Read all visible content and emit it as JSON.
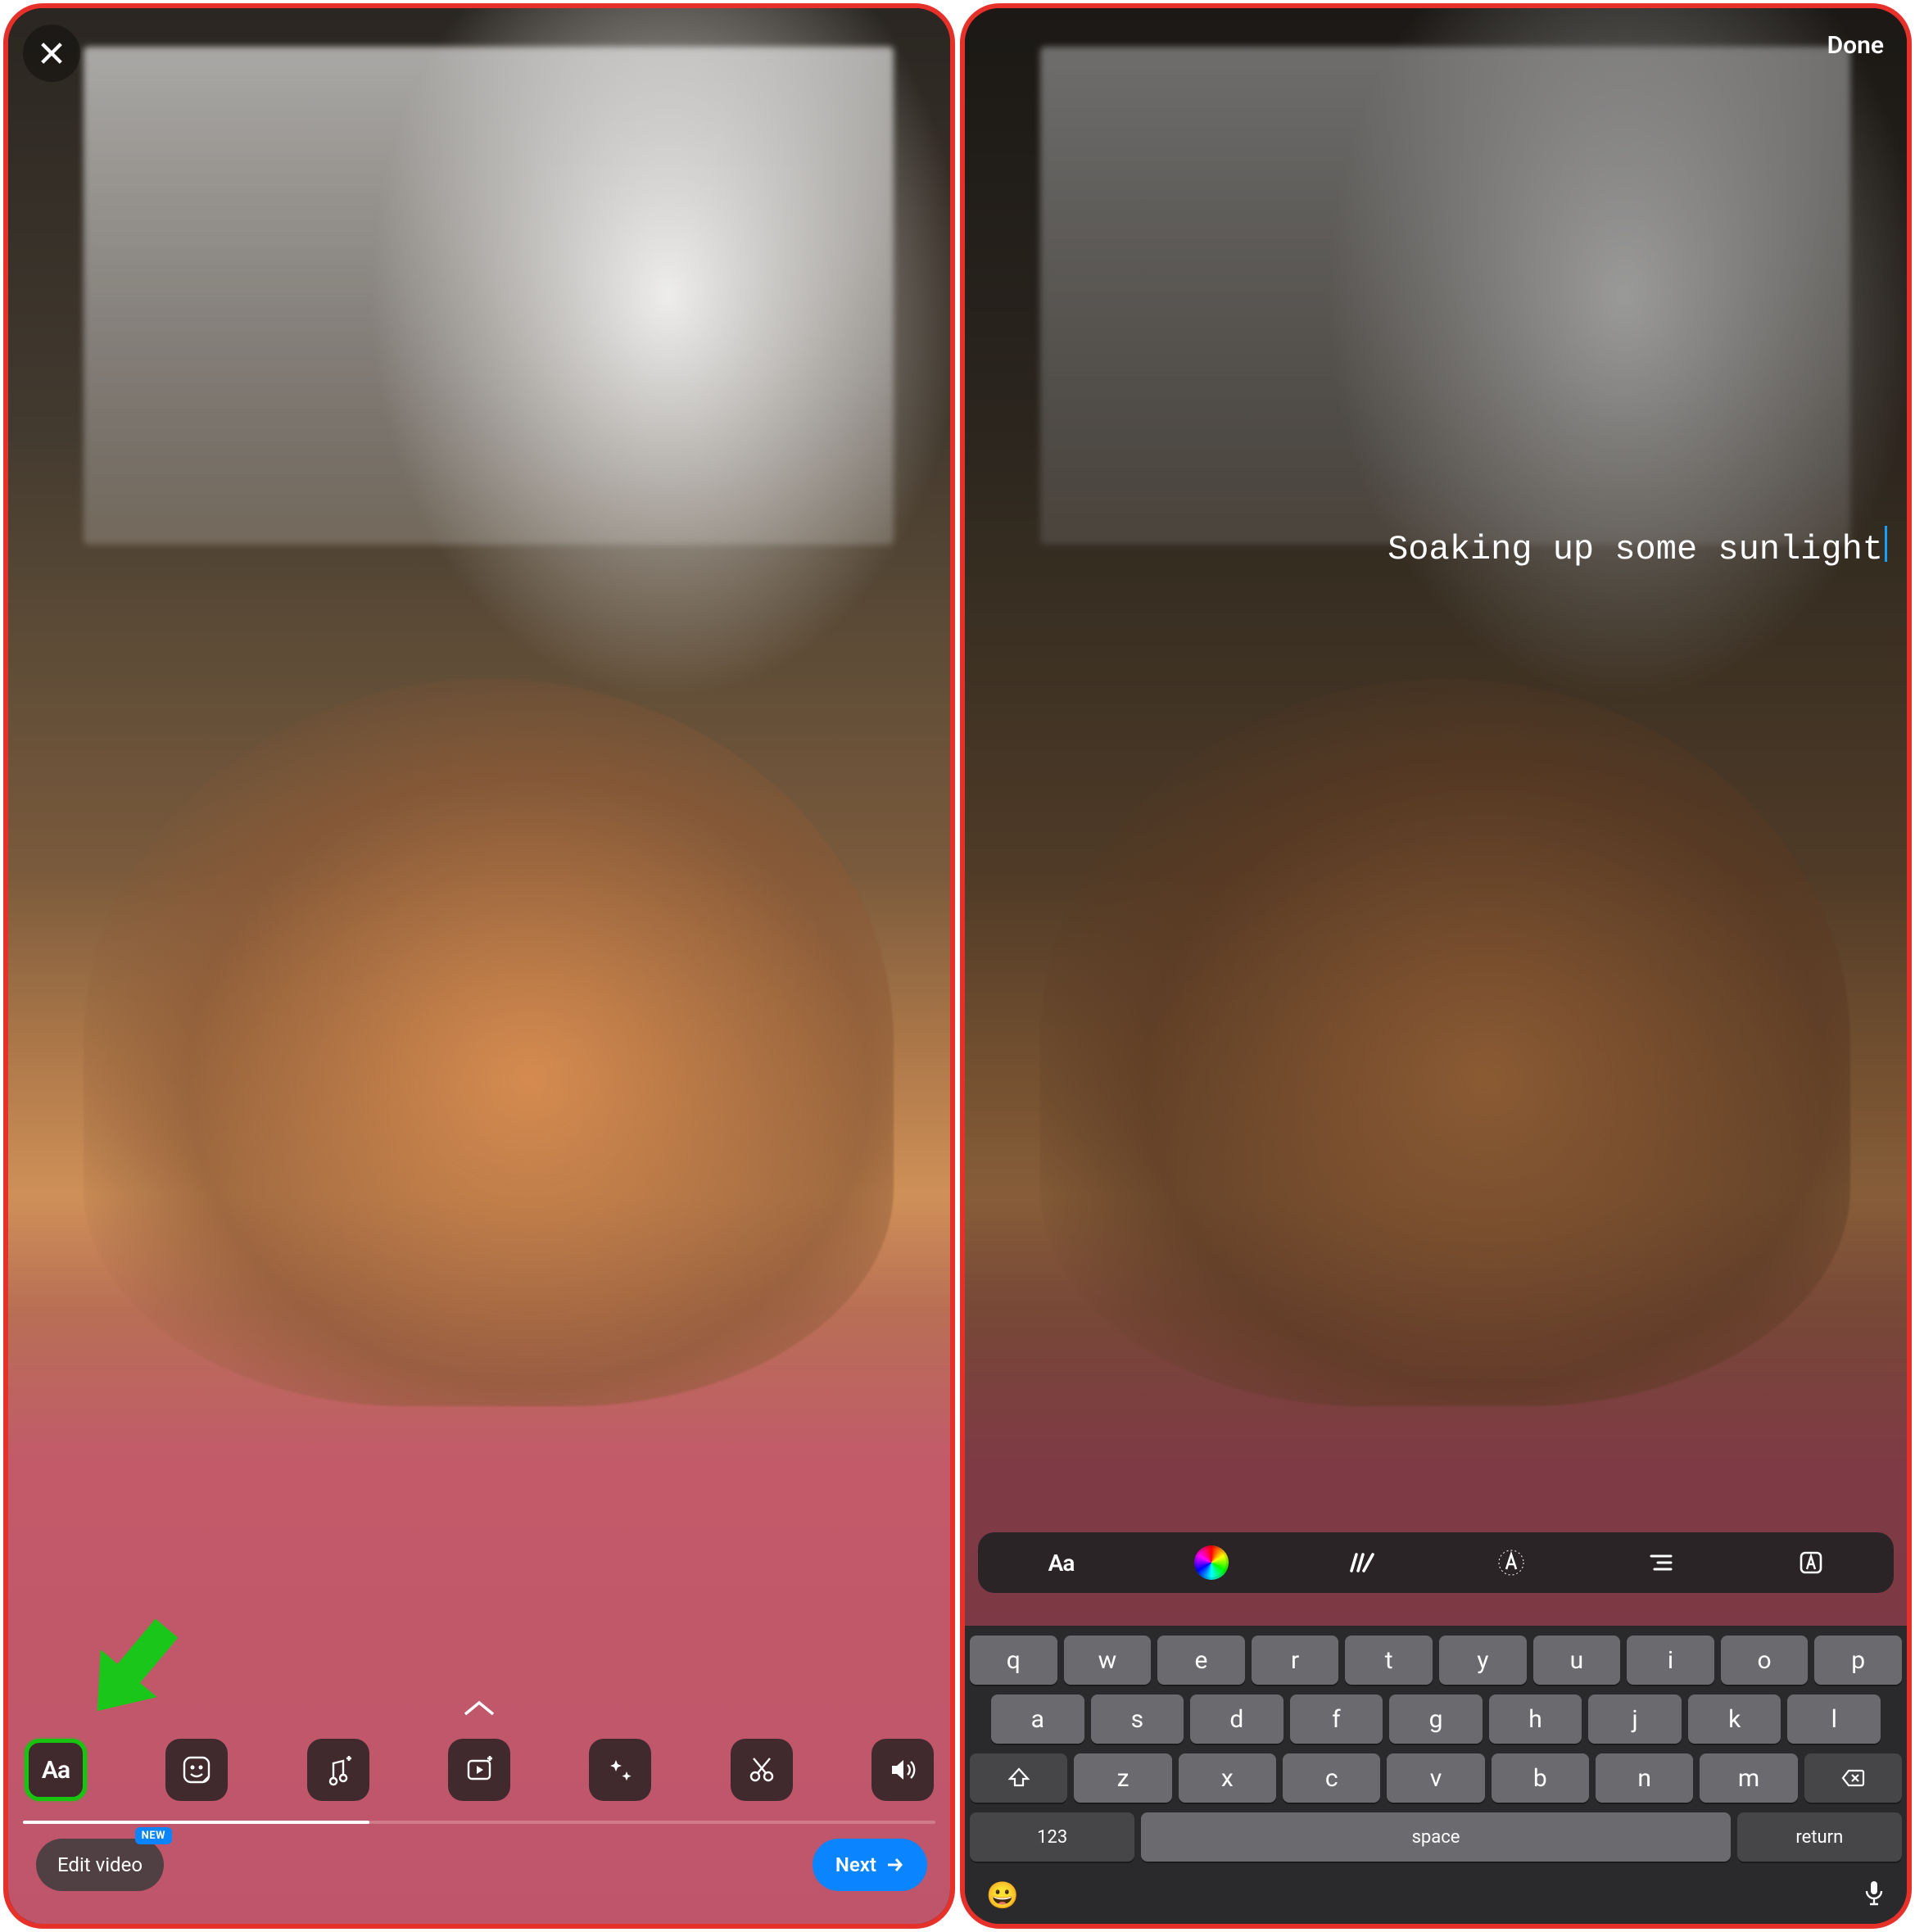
{
  "left": {
    "tools": {
      "text": "Aa"
    },
    "edit_video": "Edit video",
    "new_badge": "NEW",
    "next": "Next"
  },
  "right": {
    "done": "Done",
    "story_text": "Soaking up some sunlight",
    "text_toolbar": {
      "font": "Aa"
    },
    "keyboard": {
      "row1": [
        "q",
        "w",
        "e",
        "r",
        "t",
        "y",
        "u",
        "i",
        "o",
        "p"
      ],
      "row2": [
        "a",
        "s",
        "d",
        "f",
        "g",
        "h",
        "j",
        "k",
        "l"
      ],
      "row3": [
        "z",
        "x",
        "c",
        "v",
        "b",
        "n",
        "m"
      ],
      "numbers": "123",
      "space": "space",
      "return": "return"
    }
  }
}
